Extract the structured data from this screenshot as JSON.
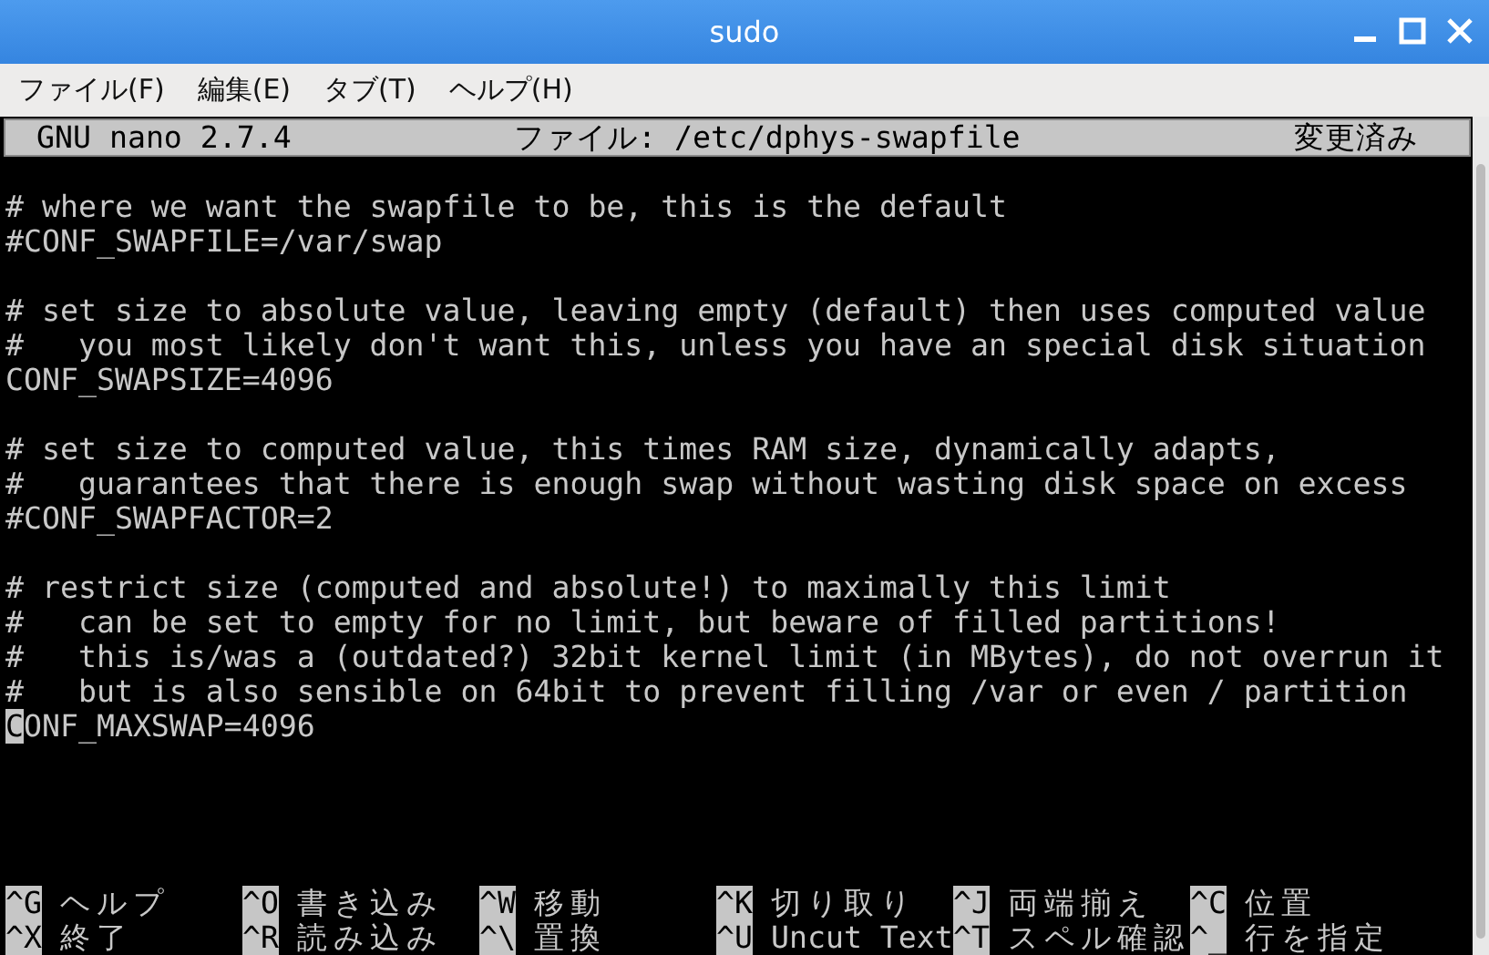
{
  "window": {
    "title": "sudo"
  },
  "menu": [
    "ファイル(F)",
    "編集(E)",
    "タブ(T)",
    "ヘルプ(H)"
  ],
  "nano_header": {
    "version": "GNU nano 2.7.4",
    "file": "ファイル: /etc/dphys-swapfile",
    "status": "変更済み"
  },
  "paragraphs": [
    {
      "lines": [
        {
          "text": "# where we want the swapfile to be, this is the default",
          "cursor": false
        },
        {
          "text": "#CONF_SWAPFILE=/var/swap",
          "cursor": false
        }
      ]
    },
    {
      "lines": [
        {
          "text": "# set size to absolute value, leaving empty (default) then uses computed value",
          "cursor": false
        },
        {
          "text": "#   you most likely don't want this, unless you have an special disk situation",
          "cursor": false
        },
        {
          "text": "CONF_SWAPSIZE=4096",
          "cursor": false
        }
      ]
    },
    {
      "lines": [
        {
          "text": "# set size to computed value, this times RAM size, dynamically adapts,",
          "cursor": false
        },
        {
          "text": "#   guarantees that there is enough swap without wasting disk space on excess",
          "cursor": false
        },
        {
          "text": "#CONF_SWAPFACTOR=2",
          "cursor": false
        }
      ]
    },
    {
      "lines": [
        {
          "text": "# restrict size (computed and absolute!) to maximally this limit",
          "cursor": false
        },
        {
          "text": "#   can be set to empty for no limit, but beware of filled partitions!",
          "cursor": false
        },
        {
          "text": "#   this is/was a (outdated?) 32bit kernel limit (in MBytes), do not overrun it",
          "cursor": false
        },
        {
          "text": "#   but is also sensible on 64bit to prevent filling /var or even / partition",
          "cursor": false
        },
        {
          "text": "CONF_MAXSWAP=4096",
          "cursor": true
        }
      ]
    }
  ],
  "shortcuts": [
    {
      "key": "^G",
      "label": "ヘルプ"
    },
    {
      "key": "^O",
      "label": "書き込み"
    },
    {
      "key": "^W",
      "label": "移動"
    },
    {
      "key": "^K",
      "label": "切り取り"
    },
    {
      "key": "^J",
      "label": "両端揃え"
    },
    {
      "key": "^C",
      "label": "位置"
    },
    {
      "key": "^X",
      "label": "終了"
    },
    {
      "key": "^R",
      "label": "読み込み"
    },
    {
      "key": "^\\",
      "label": "置換"
    },
    {
      "key": "^U",
      "label": "Uncut Text"
    },
    {
      "key": "^T",
      "label": "スペル確認"
    },
    {
      "key": "^_",
      "label": "行を指定"
    }
  ]
}
